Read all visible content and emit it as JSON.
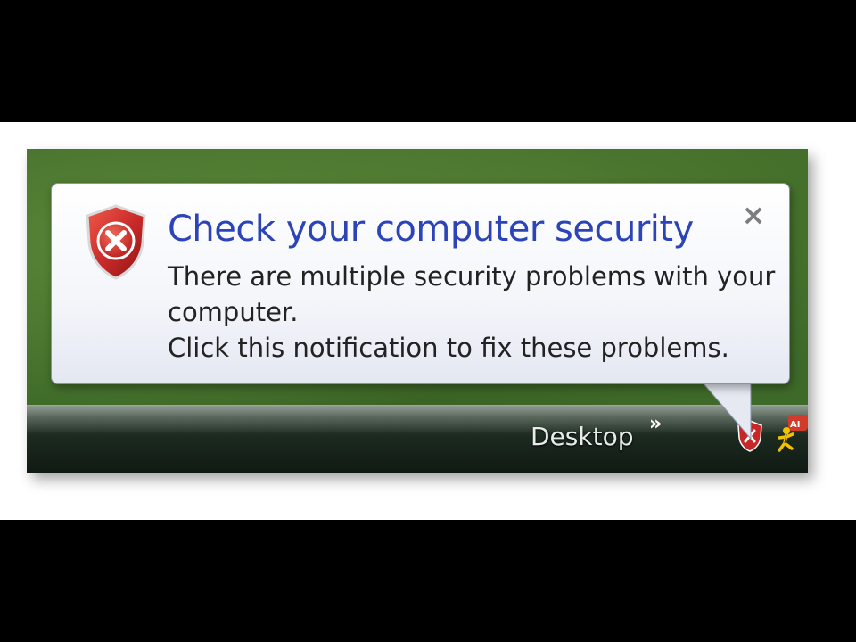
{
  "notification": {
    "title": "Check your computer security",
    "message_line1": "There are multiple security problems with your",
    "message_line2": "computer.",
    "message_line3": "Click this notification to fix these problems.",
    "close_glyph": "×",
    "icon": "shield-error-icon"
  },
  "taskbar": {
    "toolbar_label": "Desktop",
    "overflow_glyph": "»",
    "tray_icons": [
      "shield-error-icon",
      "aim-running-man-icon"
    ]
  },
  "colors": {
    "title": "#2c44b8",
    "shield_red": "#c62828",
    "desktop_green": "#3e6a29"
  }
}
